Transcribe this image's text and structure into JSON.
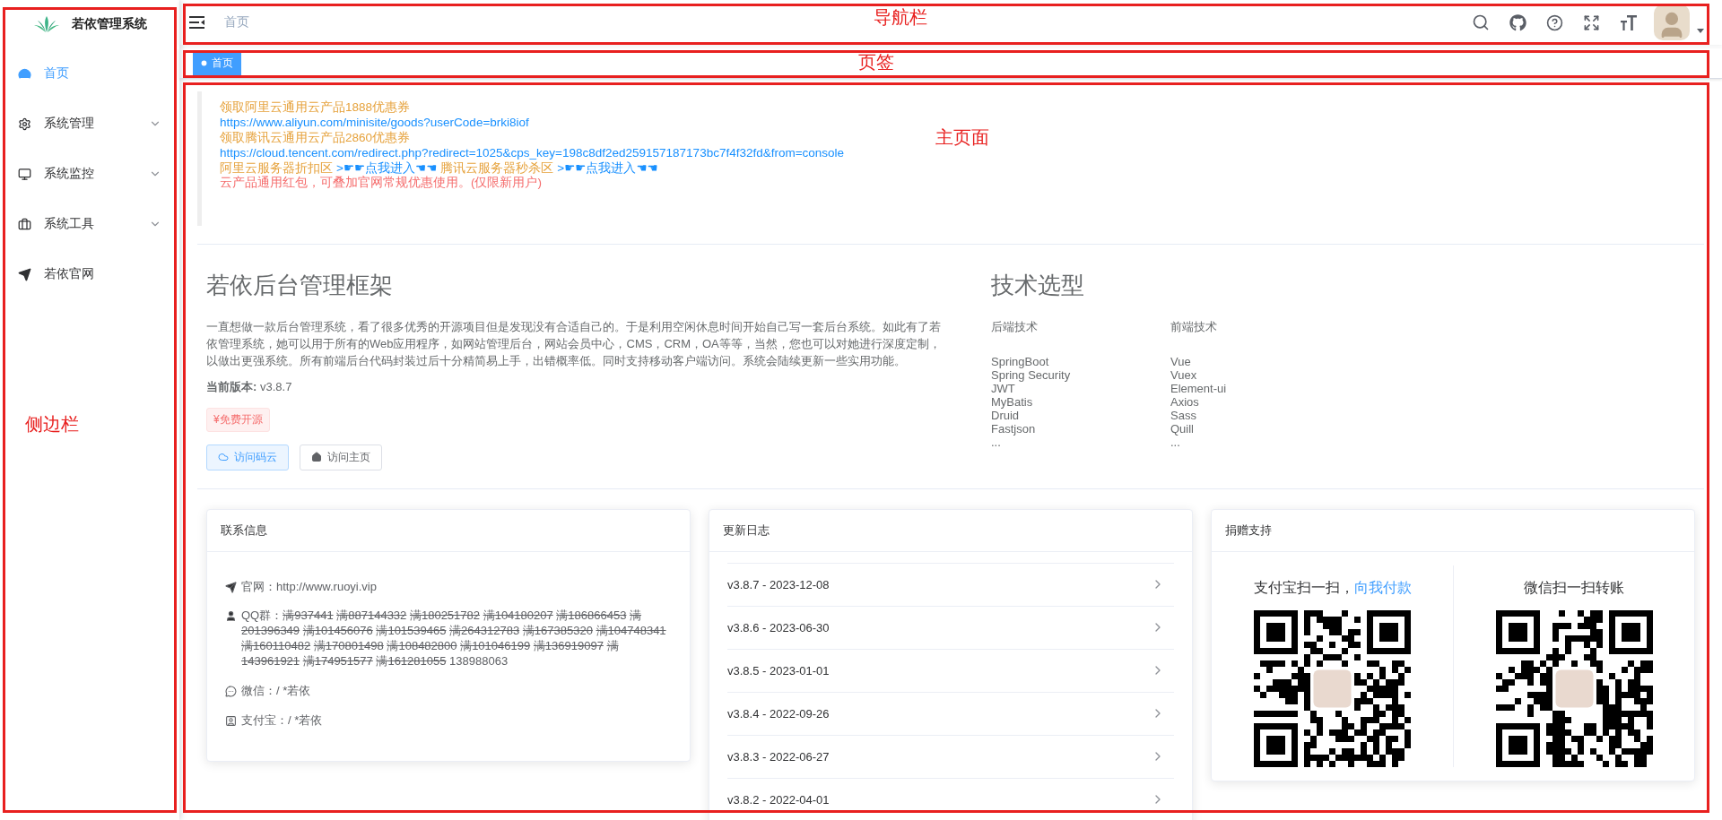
{
  "sidebar": {
    "title": "若依管理系统",
    "items": [
      {
        "label": "首页",
        "kind": "dashboard",
        "selected": true,
        "expandable": false
      },
      {
        "label": "系统管理",
        "kind": "settings",
        "selected": false,
        "expandable": true
      },
      {
        "label": "系统监控",
        "kind": "monitor",
        "selected": false,
        "expandable": true
      },
      {
        "label": "系统工具",
        "kind": "tools",
        "selected": false,
        "expandable": true
      },
      {
        "label": "若依官网",
        "kind": "link",
        "selected": false,
        "expandable": false
      }
    ]
  },
  "navbar": {
    "breadcrumb": "首页"
  },
  "tags": [
    {
      "label": "首页",
      "selected": true
    }
  ],
  "promo": [
    [
      {
        "kind": "orange",
        "text": "领取阿里云通用云产品1888优惠券"
      }
    ],
    [
      {
        "kind": "link",
        "text": "https://www.aliyun.com/minisite/goods?userCode=brki8iof"
      }
    ],
    [
      {
        "kind": "orange",
        "text": "领取腾讯云通用云产品2860优惠券"
      }
    ],
    [
      {
        "kind": "link",
        "text": "https://cloud.tencent.com/redirect.php?redirect=1025&cps_key=198c8df2ed259157187173bc7f4f32fd&from=console"
      }
    ],
    [
      {
        "kind": "orange",
        "text": "阿里云服务器折扣区"
      },
      {
        "kind": "link",
        "text": ">☛☛点我进入☚☚"
      },
      {
        "kind": "orange",
        "text": "腾讯云服务器秒杀区"
      },
      {
        "kind": "link",
        "text": ">☛☛点我进入☚☚"
      }
    ],
    [
      {
        "kind": "red",
        "text": "云产品通用红包，可叠加官网常规优惠使用。(仅限新用户)"
      }
    ]
  ],
  "intro": {
    "title": "若依后台管理框架",
    "text": "一直想做一款后台管理系统，看了很多优秀的开源项目但是发现没有合适自己的。于是利用空闲休息时间开始自己写一套后台系统。如此有了若依管理系统，她可以用于所有的Web应用程序，如网站管理后台，网站会员中心，CMS，CRM，OA等等，当然，您也可以对她进行深度定制，以做出更强系统。所有前端后台代码封装过后十分精简易上手，出错概率低。同时支持移动客户端访问。系统会陆续更新一些实用功能。",
    "version_label": "当前版本:",
    "version": "v3.8.7",
    "tag": "¥免费开源",
    "buttons": [
      {
        "label": "访问码云",
        "kind": "primary"
      },
      {
        "label": "访问主页",
        "kind": "default"
      }
    ]
  },
  "tech": {
    "title": "技术选型",
    "columns": [
      {
        "heading": "后端技术",
        "items": [
          "SpringBoot",
          "Spring Security",
          "JWT",
          "MyBatis",
          "Druid",
          "Fastjson",
          "..."
        ]
      },
      {
        "heading": "前端技术",
        "items": [
          "Vue",
          "Vuex",
          "Element-ui",
          "Axios",
          "Sass",
          "Quill",
          "..."
        ]
      }
    ]
  },
  "contact": {
    "title": "联系信息",
    "rows": [
      {
        "kind": "website",
        "label": "官网：",
        "value": "http://www.ruoyi.vip"
      },
      {
        "kind": "qq",
        "label": "QQ群：",
        "groups": [
          {
            "number": "满937441",
            "full": true
          },
          {
            "number": "满887144332",
            "full": true
          },
          {
            "number": "满180251782",
            "full": true
          },
          {
            "number": "满104180207",
            "full": true
          },
          {
            "number": "满186866453",
            "full": true
          },
          {
            "number": "满201396349",
            "full": true
          },
          {
            "number": "满101456076",
            "full": true
          },
          {
            "number": "满101539465",
            "full": true
          },
          {
            "number": "满264312783",
            "full": true
          },
          {
            "number": "满167385320",
            "full": true
          },
          {
            "number": "满104748341",
            "full": true
          },
          {
            "number": "满160110482",
            "full": true
          },
          {
            "number": "满170801498",
            "full": true
          },
          {
            "number": "满108482800",
            "full": true
          },
          {
            "number": "满101046199",
            "full": true
          },
          {
            "number": "满136919097",
            "full": true
          },
          {
            "number": "满143961921",
            "full": true
          },
          {
            "number": "满174951577",
            "full": true
          },
          {
            "number": "满161281055",
            "full": true
          },
          {
            "number": "138988063",
            "full": false
          }
        ]
      },
      {
        "kind": "wechat",
        "label": "微信：",
        "value": "/ *若依"
      },
      {
        "kind": "alipay",
        "label": "支付宝：",
        "value": "/ *若依"
      }
    ]
  },
  "changelog": {
    "title": "更新日志",
    "items": [
      "v3.8.7 - 2023-12-08",
      "v3.8.6 - 2023-06-30",
      "v3.8.5 - 2023-01-01",
      "v3.8.4 - 2022-09-26",
      "v3.8.3 - 2022-06-27",
      "v3.8.2 - 2022-04-01"
    ]
  },
  "donate": {
    "title": "捐赠支持",
    "columns": [
      {
        "heading": "支付宝扫一扫，",
        "highlight": "向我付款"
      },
      {
        "heading": "微信扫一扫转账"
      }
    ]
  },
  "annotations": [
    {
      "kind": "navbar",
      "label": "导航栏"
    },
    {
      "kind": "tags",
      "label": "页签"
    },
    {
      "kind": "main",
      "label": "主页面"
    },
    {
      "kind": "sidebar",
      "label": "侧边栏"
    }
  ]
}
